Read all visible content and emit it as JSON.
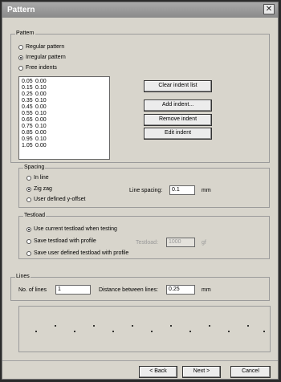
{
  "window": {
    "title": "Pattern"
  },
  "pattern": {
    "group_label": "Pattern",
    "options": [
      {
        "label": "Regular pattern",
        "selected": false
      },
      {
        "label": "Irregular pattern",
        "selected": true
      },
      {
        "label": "Free indents",
        "selected": false
      }
    ],
    "rows": [
      [
        "0.05",
        "0.00"
      ],
      [
        "0.15",
        "0.10"
      ],
      [
        "0.25",
        "0.00"
      ],
      [
        "0.35",
        "0.10"
      ],
      [
        "0.45",
        "0.00"
      ],
      [
        "0.55",
        "0.10"
      ],
      [
        "0.65",
        "0.00"
      ],
      [
        "0.75",
        "0.10"
      ],
      [
        "0.85",
        "0.00"
      ],
      [
        "0.95",
        "0.10"
      ],
      [
        "1.05",
        "0.00"
      ]
    ],
    "buttons": {
      "clear": "Clear indent list",
      "add": "Add indent...",
      "remove": "Remove indent",
      "edit": "Edit indent"
    }
  },
  "spacing": {
    "group_label": "Spacing",
    "options": [
      {
        "label": "In line",
        "selected": false
      },
      {
        "label": "Zig zag",
        "selected": true
      },
      {
        "label": "User defined y-offset",
        "selected": false
      }
    ],
    "line_spacing_label": "Line spacing:",
    "line_spacing_value": "0.1",
    "unit": "mm"
  },
  "testload": {
    "group_label": "Testload",
    "options": [
      {
        "label": "Use current testload when testing",
        "selected": true
      },
      {
        "label": "Save testload with profile",
        "selected": false
      },
      {
        "label": "Save user defined testload with profile",
        "selected": false
      }
    ],
    "testload_label": "Testload:",
    "testload_value": "1000",
    "unit": "gf"
  },
  "lines": {
    "group_label": "Lines",
    "count_label": "No. of lines",
    "count_value": "1",
    "distance_label": "Distance between lines:",
    "distance_value": "0.25",
    "unit": "mm"
  },
  "footer": {
    "back": "< Back",
    "next": "Next >",
    "cancel": "Cancel"
  }
}
